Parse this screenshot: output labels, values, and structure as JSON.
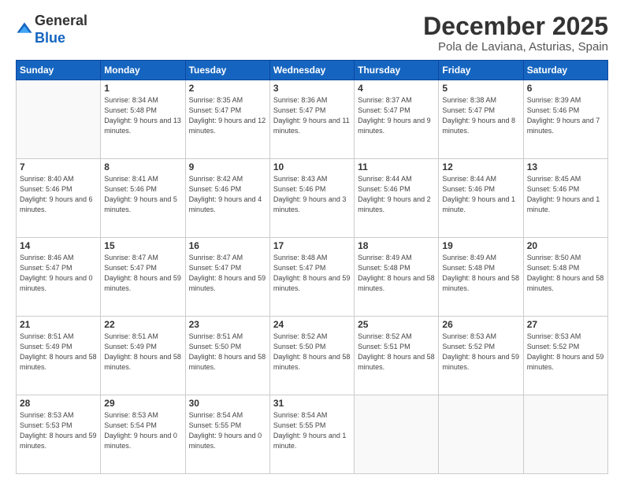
{
  "header": {
    "logo_general": "General",
    "logo_blue": "Blue",
    "month_title": "December 2025",
    "location": "Pola de Laviana, Asturias, Spain"
  },
  "days_of_week": [
    "Sunday",
    "Monday",
    "Tuesday",
    "Wednesday",
    "Thursday",
    "Friday",
    "Saturday"
  ],
  "weeks": [
    [
      {
        "day": "",
        "info": ""
      },
      {
        "day": "1",
        "info": "Sunrise: 8:34 AM\nSunset: 5:48 PM\nDaylight: 9 hours\nand 13 minutes."
      },
      {
        "day": "2",
        "info": "Sunrise: 8:35 AM\nSunset: 5:47 PM\nDaylight: 9 hours\nand 12 minutes."
      },
      {
        "day": "3",
        "info": "Sunrise: 8:36 AM\nSunset: 5:47 PM\nDaylight: 9 hours\nand 11 minutes."
      },
      {
        "day": "4",
        "info": "Sunrise: 8:37 AM\nSunset: 5:47 PM\nDaylight: 9 hours\nand 9 minutes."
      },
      {
        "day": "5",
        "info": "Sunrise: 8:38 AM\nSunset: 5:47 PM\nDaylight: 9 hours\nand 8 minutes."
      },
      {
        "day": "6",
        "info": "Sunrise: 8:39 AM\nSunset: 5:46 PM\nDaylight: 9 hours\nand 7 minutes."
      }
    ],
    [
      {
        "day": "7",
        "info": "Sunrise: 8:40 AM\nSunset: 5:46 PM\nDaylight: 9 hours\nand 6 minutes."
      },
      {
        "day": "8",
        "info": "Sunrise: 8:41 AM\nSunset: 5:46 PM\nDaylight: 9 hours\nand 5 minutes."
      },
      {
        "day": "9",
        "info": "Sunrise: 8:42 AM\nSunset: 5:46 PM\nDaylight: 9 hours\nand 4 minutes."
      },
      {
        "day": "10",
        "info": "Sunrise: 8:43 AM\nSunset: 5:46 PM\nDaylight: 9 hours\nand 3 minutes."
      },
      {
        "day": "11",
        "info": "Sunrise: 8:44 AM\nSunset: 5:46 PM\nDaylight: 9 hours\nand 2 minutes."
      },
      {
        "day": "12",
        "info": "Sunrise: 8:44 AM\nSunset: 5:46 PM\nDaylight: 9 hours\nand 1 minute."
      },
      {
        "day": "13",
        "info": "Sunrise: 8:45 AM\nSunset: 5:46 PM\nDaylight: 9 hours\nand 1 minute."
      }
    ],
    [
      {
        "day": "14",
        "info": "Sunrise: 8:46 AM\nSunset: 5:47 PM\nDaylight: 9 hours\nand 0 minutes."
      },
      {
        "day": "15",
        "info": "Sunrise: 8:47 AM\nSunset: 5:47 PM\nDaylight: 8 hours\nand 59 minutes."
      },
      {
        "day": "16",
        "info": "Sunrise: 8:47 AM\nSunset: 5:47 PM\nDaylight: 8 hours\nand 59 minutes."
      },
      {
        "day": "17",
        "info": "Sunrise: 8:48 AM\nSunset: 5:47 PM\nDaylight: 8 hours\nand 59 minutes."
      },
      {
        "day": "18",
        "info": "Sunrise: 8:49 AM\nSunset: 5:48 PM\nDaylight: 8 hours\nand 58 minutes."
      },
      {
        "day": "19",
        "info": "Sunrise: 8:49 AM\nSunset: 5:48 PM\nDaylight: 8 hours\nand 58 minutes."
      },
      {
        "day": "20",
        "info": "Sunrise: 8:50 AM\nSunset: 5:48 PM\nDaylight: 8 hours\nand 58 minutes."
      }
    ],
    [
      {
        "day": "21",
        "info": "Sunrise: 8:51 AM\nSunset: 5:49 PM\nDaylight: 8 hours\nand 58 minutes."
      },
      {
        "day": "22",
        "info": "Sunrise: 8:51 AM\nSunset: 5:49 PM\nDaylight: 8 hours\nand 58 minutes."
      },
      {
        "day": "23",
        "info": "Sunrise: 8:51 AM\nSunset: 5:50 PM\nDaylight: 8 hours\nand 58 minutes."
      },
      {
        "day": "24",
        "info": "Sunrise: 8:52 AM\nSunset: 5:50 PM\nDaylight: 8 hours\nand 58 minutes."
      },
      {
        "day": "25",
        "info": "Sunrise: 8:52 AM\nSunset: 5:51 PM\nDaylight: 8 hours\nand 58 minutes."
      },
      {
        "day": "26",
        "info": "Sunrise: 8:53 AM\nSunset: 5:52 PM\nDaylight: 8 hours\nand 59 minutes."
      },
      {
        "day": "27",
        "info": "Sunrise: 8:53 AM\nSunset: 5:52 PM\nDaylight: 8 hours\nand 59 minutes."
      }
    ],
    [
      {
        "day": "28",
        "info": "Sunrise: 8:53 AM\nSunset: 5:53 PM\nDaylight: 8 hours\nand 59 minutes."
      },
      {
        "day": "29",
        "info": "Sunrise: 8:53 AM\nSunset: 5:54 PM\nDaylight: 9 hours\nand 0 minutes."
      },
      {
        "day": "30",
        "info": "Sunrise: 8:54 AM\nSunset: 5:55 PM\nDaylight: 9 hours\nand 0 minutes."
      },
      {
        "day": "31",
        "info": "Sunrise: 8:54 AM\nSunset: 5:55 PM\nDaylight: 9 hours\nand 1 minute."
      },
      {
        "day": "",
        "info": ""
      },
      {
        "day": "",
        "info": ""
      },
      {
        "day": "",
        "info": ""
      }
    ]
  ]
}
